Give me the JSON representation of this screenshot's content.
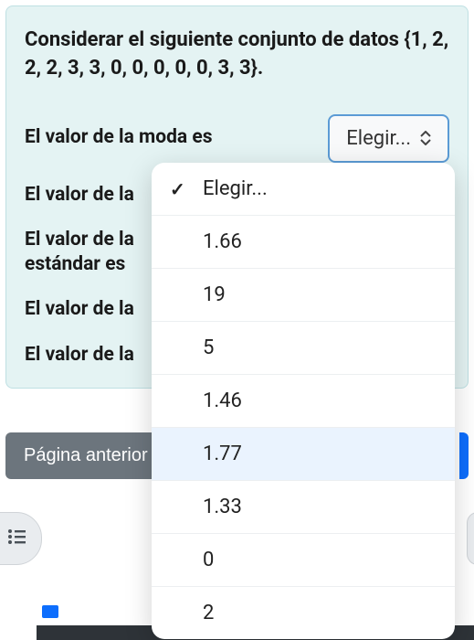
{
  "card": {
    "title": "Considerar el siguiente conjunto de datos {1, 2, 2, 2, 3, 3, 0, 0, 0, 0, 0, 3, 3}.",
    "rows": {
      "moda": "El valor de la moda es",
      "r2": "El valor de la",
      "r3a": "El valor de la",
      "r3b": "estándar es",
      "r4": "El valor de la",
      "r5": "El valor de la"
    },
    "select_label": "Elegir..."
  },
  "nav": {
    "prev": "Página anterior"
  },
  "dropdown": {
    "items": [
      {
        "label": "Elegir...",
        "selected": true
      },
      {
        "label": "1.66"
      },
      {
        "label": "19"
      },
      {
        "label": "5"
      },
      {
        "label": "1.46"
      },
      {
        "label": "1.77",
        "highlight": true
      },
      {
        "label": "1.33"
      },
      {
        "label": "0"
      },
      {
        "label": "2"
      }
    ]
  }
}
